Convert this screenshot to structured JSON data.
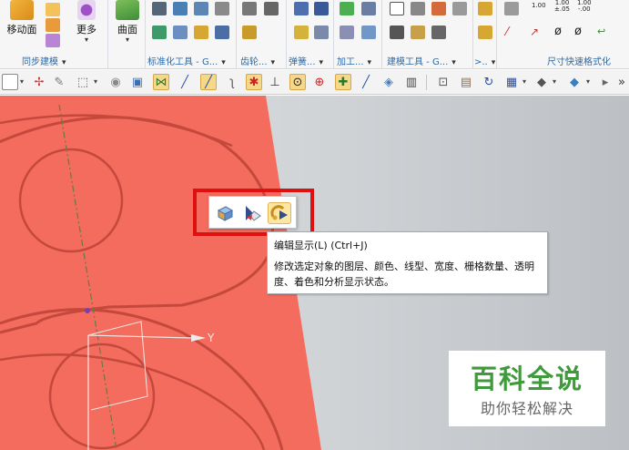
{
  "ribbon": {
    "sync_modeling": {
      "move_face_label": "移动面",
      "more_label": "更多",
      "group_label": "同步建模"
    },
    "surface": {
      "label": "曲面"
    },
    "groups": [
      {
        "label": "标准化工具 - G..."
      },
      {
        "label": "齿轮..."
      },
      {
        "label": "弹簧..."
      },
      {
        "label": "加工..."
      },
      {
        "label": "建模工具 - G..."
      },
      {
        "label": ">.."
      },
      {
        "label": "尺寸快速格式化"
      }
    ],
    "dim_format": {
      "v1": "1.00",
      "v2a": "1.00",
      "v2b": "±.05",
      "v3a": "1.00",
      "v3b": "-.00"
    }
  },
  "mini_toolbar": {
    "icons": [
      "part-cube-icon",
      "move-object-icon",
      "edit-display-icon"
    ]
  },
  "tooltip": {
    "title": "编辑显示(L) (Ctrl+J)",
    "description": "修改选定对象的图层、颜色、线型、宽度、栅格数量、透明度、着色和分析显示状态。"
  },
  "viewport": {
    "axis_y_label": "Y",
    "colors": {
      "solid": "#f36c5e",
      "edges": "#c4493c",
      "background": "#d6d8db",
      "highlight": "#e01010"
    }
  },
  "watermark": {
    "title": "百科全说",
    "subtitle": "助你轻松解决"
  }
}
